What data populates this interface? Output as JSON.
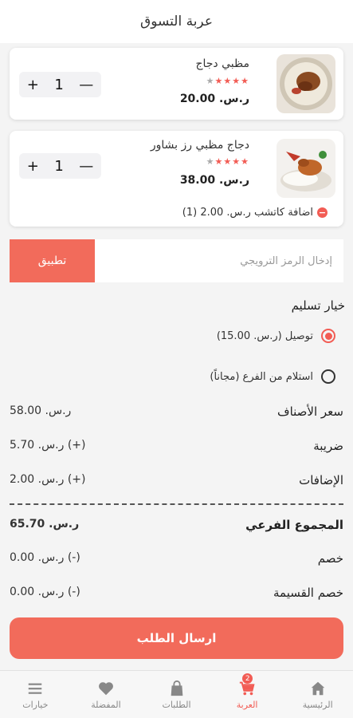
{
  "header": {
    "title": "عربة التسوق"
  },
  "items": [
    {
      "name": "مظبي دجاج",
      "rating": 4,
      "max_rating": 5,
      "price": "ر.س. 20.00",
      "qty": "1",
      "plus": "+",
      "minus": "—"
    },
    {
      "name": "دجاج مظبي رز بشاور",
      "rating": 4,
      "max_rating": 5,
      "price": "ر.س. 38.00",
      "qty": "1",
      "plus": "+",
      "minus": "—",
      "addon": {
        "text": "اضافة كاتشب ر.س. 2.00 (1)",
        "icon": "minus-circle-icon"
      }
    }
  ],
  "promo": {
    "placeholder": "إدخال الرمز الترويجي",
    "button": "تطبيق"
  },
  "delivery": {
    "title": "خيار تسليم",
    "options": [
      {
        "label": "توصيل  (ر.س. 15.00)",
        "selected": true
      },
      {
        "label": "استلام من الفرع  (مجاناً)",
        "selected": false
      }
    ]
  },
  "summary": {
    "items_price": {
      "label": "سعر الأصناف",
      "value": "ر.س. 58.00"
    },
    "tax": {
      "label": "ضريبة",
      "value": "(+) ر.س. 5.70"
    },
    "addons": {
      "label": "الإضافات",
      "value": "(+) ر.س. 2.00"
    },
    "subtotal": {
      "label": "المجموع الفرعي",
      "value": "ر.س. 65.70"
    },
    "discount": {
      "label": "خصم",
      "value": "(-) ر.س. 0.00"
    },
    "coupon": {
      "label": "خصم القسيمة",
      "value": "(-) ر.س. 0.00"
    }
  },
  "submit": {
    "label": "ارسال الطلب"
  },
  "tabs": [
    {
      "label": "الرئيسية",
      "icon": "home-icon"
    },
    {
      "label": "العربة",
      "icon": "cart-icon",
      "badge": "2",
      "active": true
    },
    {
      "label": "الطلبات",
      "icon": "bag-icon"
    },
    {
      "label": "المفضلة",
      "icon": "heart-icon"
    },
    {
      "label": "خيارات",
      "icon": "menu-icon"
    }
  ],
  "colors": {
    "accent": "#f25c54",
    "button": "#f26b5b"
  }
}
